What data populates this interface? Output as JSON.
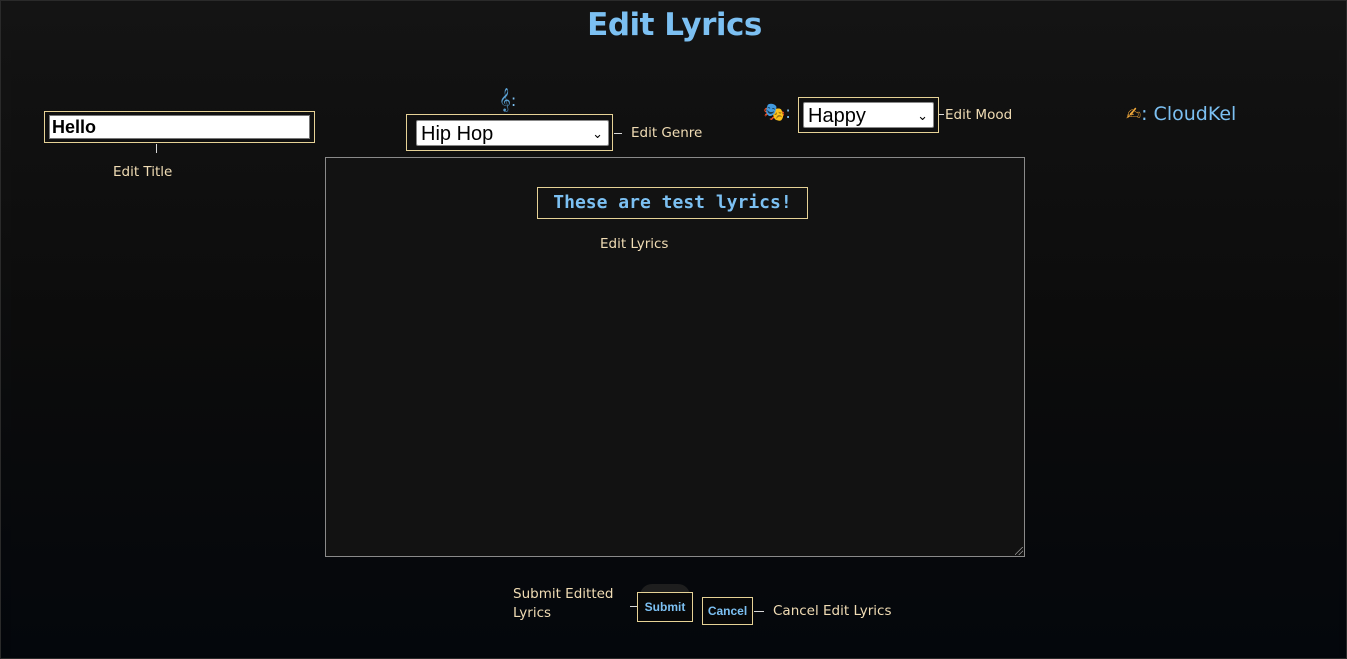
{
  "page": {
    "title": "Edit Lyrics"
  },
  "title_field": {
    "value": "Hello",
    "caption": "Edit Title"
  },
  "genre": {
    "icon": "treble-clef-icon",
    "icon_glyph": "𝄞",
    "separator": ":",
    "selected": "Hip Hop",
    "caption": "Edit Genre"
  },
  "mood": {
    "icon": "theater-masks-icon",
    "icon_glyph": "🎭",
    "separator": ":",
    "selected": "Happy",
    "caption": "Edit Mood"
  },
  "author": {
    "icon": "writing-hand-icon",
    "icon_glyph": "✍",
    "separator": ":",
    "name": "CloudKel"
  },
  "lyrics": {
    "text": "These are test lyrics!",
    "caption": "Edit Lyrics"
  },
  "actions": {
    "submit_caption_line1": "Submit Editted",
    "submit_caption_line2": "Lyrics",
    "submit_label": "Submit",
    "cancel_label": "Cancel",
    "cancel_caption": "Cancel Edit Lyrics"
  },
  "colors": {
    "accent": "#7cc0f2",
    "caption": "#f0dcb4",
    "frame": "#e6d296",
    "background": "#0e0e0e"
  }
}
